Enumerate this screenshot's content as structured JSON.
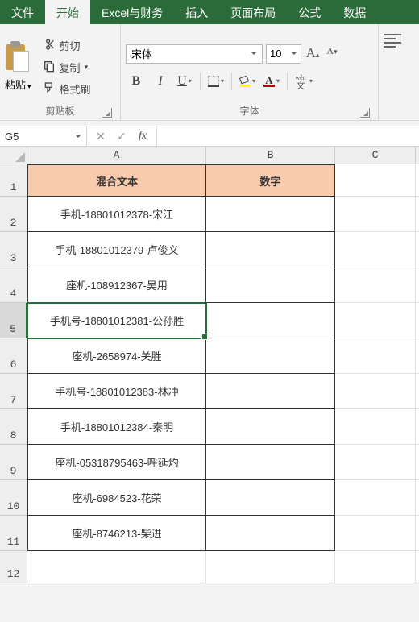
{
  "tabs": {
    "file": "文件",
    "home": "开始",
    "excel_finance": "Excel与财务",
    "insert": "插入",
    "layout": "页面布局",
    "formula": "公式",
    "data": "数据"
  },
  "ribbon": {
    "clipboard": {
      "paste": "粘贴",
      "cut": "剪切",
      "copy": "复制",
      "format_painter": "格式刷",
      "group_label": "剪贴板"
    },
    "font": {
      "name": "宋体",
      "size": "10",
      "group_label": "字体",
      "bold": "B",
      "italic": "I",
      "underline": "U",
      "font_color_letter": "A",
      "wen": "wén",
      "wen_char": "文"
    }
  },
  "formula_bar": {
    "name_box": "G5",
    "cancel": "✕",
    "enter": "✓",
    "fx": "fx"
  },
  "sheet": {
    "columns": [
      "A",
      "B",
      "C"
    ],
    "row_numbers": [
      "1",
      "2",
      "3",
      "4",
      "5",
      "6",
      "7",
      "8",
      "9",
      "10",
      "11",
      "12"
    ],
    "selected": {
      "row": 5,
      "col": "A"
    },
    "header_row": {
      "A": "混合文本",
      "B": "数字"
    },
    "data": [
      {
        "A": "手机-18801012378-宋江",
        "B": ""
      },
      {
        "A": "手机-18801012379-卢俊义",
        "B": ""
      },
      {
        "A": "座机-108912367-吴用",
        "B": ""
      },
      {
        "A": "手机号-18801012381-公孙胜",
        "B": ""
      },
      {
        "A": "座机-2658974-关胜",
        "B": ""
      },
      {
        "A": "手机号-18801012383-林冲",
        "B": ""
      },
      {
        "A": "手机-18801012384-秦明",
        "B": ""
      },
      {
        "A": "座机-05318795463-呼延灼",
        "B": ""
      },
      {
        "A": "座机-6984523-花荣",
        "B": ""
      },
      {
        "A": "座机-8746213-柴进",
        "B": ""
      }
    ]
  },
  "colors": {
    "fill_highlight": "#ffff00",
    "font_color": "#c00000"
  }
}
